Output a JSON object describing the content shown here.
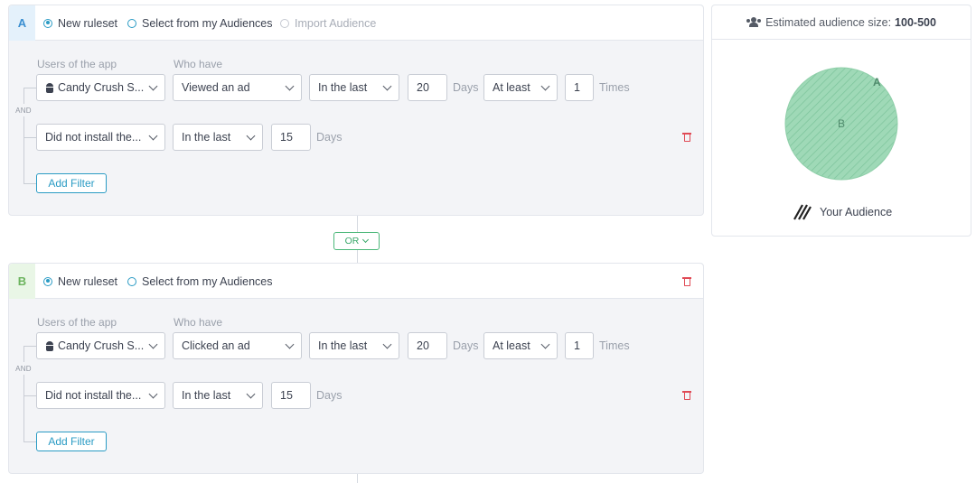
{
  "rulesets": [
    {
      "letter": "A",
      "options": {
        "new_ruleset": "New ruleset",
        "select_audiences": "Select from my Audiences",
        "import_audience": "Import Audience"
      },
      "labels": {
        "users_of_app": "Users of the app",
        "who_have": "Who have"
      },
      "and_label": "AND",
      "row1": {
        "app": "Candy Crush S...",
        "event": "Viewed an ad",
        "time_range": "In the last",
        "days_value": "20",
        "days_unit": "Days",
        "frequency": "At least",
        "times_value": "1",
        "times_unit": "Times"
      },
      "row2": {
        "condition": "Did not install the...",
        "time_range": "In the last",
        "days_value": "15",
        "days_unit": "Days"
      },
      "add_filter": "Add Filter"
    },
    {
      "letter": "B",
      "options": {
        "new_ruleset": "New ruleset",
        "select_audiences": "Select from my Audiences"
      },
      "labels": {
        "users_of_app": "Users of the app",
        "who_have": "Who have"
      },
      "and_label": "AND",
      "row1": {
        "app": "Candy Crush S...",
        "event": "Clicked an ad",
        "time_range": "In the last",
        "days_value": "20",
        "days_unit": "Days",
        "frequency": "At least",
        "times_value": "1",
        "times_unit": "Times"
      },
      "row2": {
        "condition": "Did not install the...",
        "time_range": "In the last",
        "days_value": "15",
        "days_unit": "Days"
      },
      "add_filter": "Add Filter"
    }
  ],
  "combiner": {
    "label": "OR"
  },
  "estimate": {
    "label": "Estimated audience size:",
    "value": "100-500",
    "venn_labels": [
      "A",
      "B"
    ],
    "legend": "Your Audience"
  },
  "colors": {
    "accent": "#2a9bc4",
    "venn_fill": "#9fd9b7",
    "venn_hatch": "#7cc49b",
    "or_green": "#3aa86a",
    "delete_red": "#e04a55"
  },
  "icons": [
    "android-icon",
    "chevron-down-icon",
    "trash-icon",
    "users-icon",
    "hatch-legend-icon"
  ]
}
